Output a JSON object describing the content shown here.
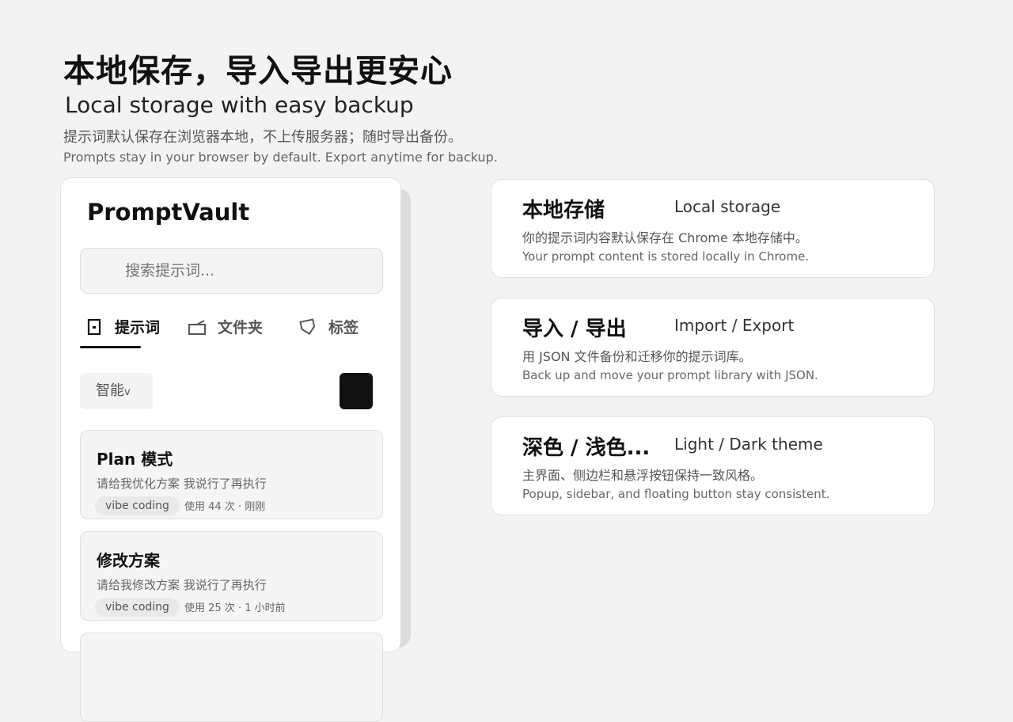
{
  "hero": {
    "title": "本地保存，导入导出更安心",
    "subtitle": "Local storage with easy backup",
    "description_zh": "提示词默认保存在浏览器本地，不上传服务器；随时导出备份。",
    "description_en": "Prompts stay in your browser by default. Export anytime for backup."
  },
  "panel": {
    "app_name": "PromptVault",
    "search": {
      "placeholder": "搜索提示词..."
    },
    "tabs": [
      {
        "label": "提示词",
        "icon": "document-icon",
        "active": true
      },
      {
        "label": "文件夹",
        "icon": "folder-icon",
        "active": false
      },
      {
        "label": "标签",
        "icon": "tag-icon",
        "active": false
      }
    ],
    "sort": {
      "label": "智能",
      "chevron": "v"
    },
    "prompts": [
      {
        "title": "Plan 模式",
        "description": "请给我优化方案 我说行了再执行",
        "tag": "vibe coding",
        "meta": "使用 44 次 · 刚刚"
      },
      {
        "title": "修改方案",
        "description": "请给我修改方案 我说行了再执行",
        "tag": "vibe coding",
        "meta": "使用 25 次 · 1 小时前"
      }
    ]
  },
  "features": [
    {
      "title": "本地存储",
      "title_en": "Local storage",
      "desc_zh": "你的提示词内容默认保存在 Chrome 本地存储中。",
      "desc_en": "Your prompt content is stored locally in Chrome."
    },
    {
      "title": "导入 / 导出",
      "title_en": "Import / Export",
      "desc_zh": "用 JSON 文件备份和迁移你的提示词库。",
      "desc_en": "Back up and move your prompt library with JSON."
    },
    {
      "title": "深色 / 浅色...",
      "title_en": "Light / Dark theme",
      "desc_zh": "主界面、侧边栏和悬浮按钮保持一致风格。",
      "desc_en": "Popup, sidebar, and floating button stay consistent."
    }
  ],
  "colors": {
    "background": "#f3f3f3",
    "accent": "#111111",
    "card": "#ffffff"
  }
}
